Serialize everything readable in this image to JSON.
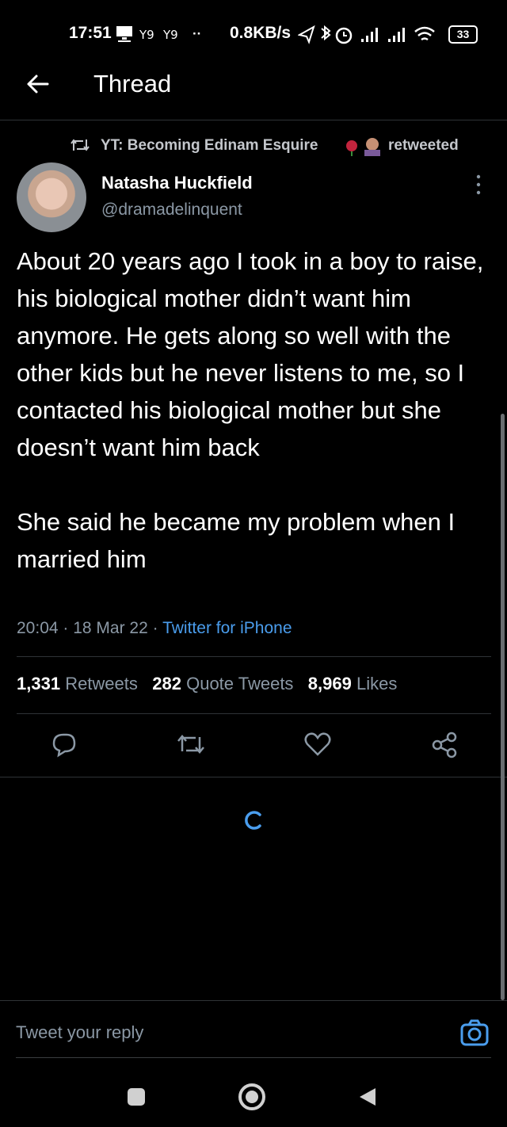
{
  "status_bar": {
    "time": "17:51",
    "signal_extra": "··",
    "net_speed": "0.8KB/s",
    "battery": "33"
  },
  "header": {
    "title": "Thread"
  },
  "retweet": {
    "by": "YT: Becoming Edinam Esquire",
    "suffix": "retweeted"
  },
  "tweet": {
    "name": "Natasha Huckfield",
    "handle": "@dramadelinquent",
    "text": "About 20 years ago I took in a boy to raise, his biological mother didn’t want him anymore. He gets along so well with the other kids but he never listens to me, so I contacted his biological mother but she doesn’t want him back\n\nShe said he became my problem when I married him",
    "time": "20:04",
    "date": "18 Mar 22",
    "source": "Twitter for iPhone"
  },
  "stats": {
    "retweets": "1,331",
    "retweets_label": "Retweets",
    "quotes": "282",
    "quotes_label": "Quote Tweets",
    "likes": "8,969",
    "likes_label": "Likes"
  },
  "reply": {
    "placeholder": "Tweet your reply"
  },
  "colors": {
    "accent": "#4a9ded",
    "muted": "#8b98a5",
    "background": "#000000"
  },
  "icons": [
    "back-arrow-icon",
    "retweet-icon",
    "more-icon",
    "reply-icon",
    "retweet-action-icon",
    "like-icon",
    "share-icon",
    "loading-spinner-icon",
    "camera-icon",
    "nav-square-icon",
    "nav-circle-icon",
    "nav-back-icon"
  ]
}
